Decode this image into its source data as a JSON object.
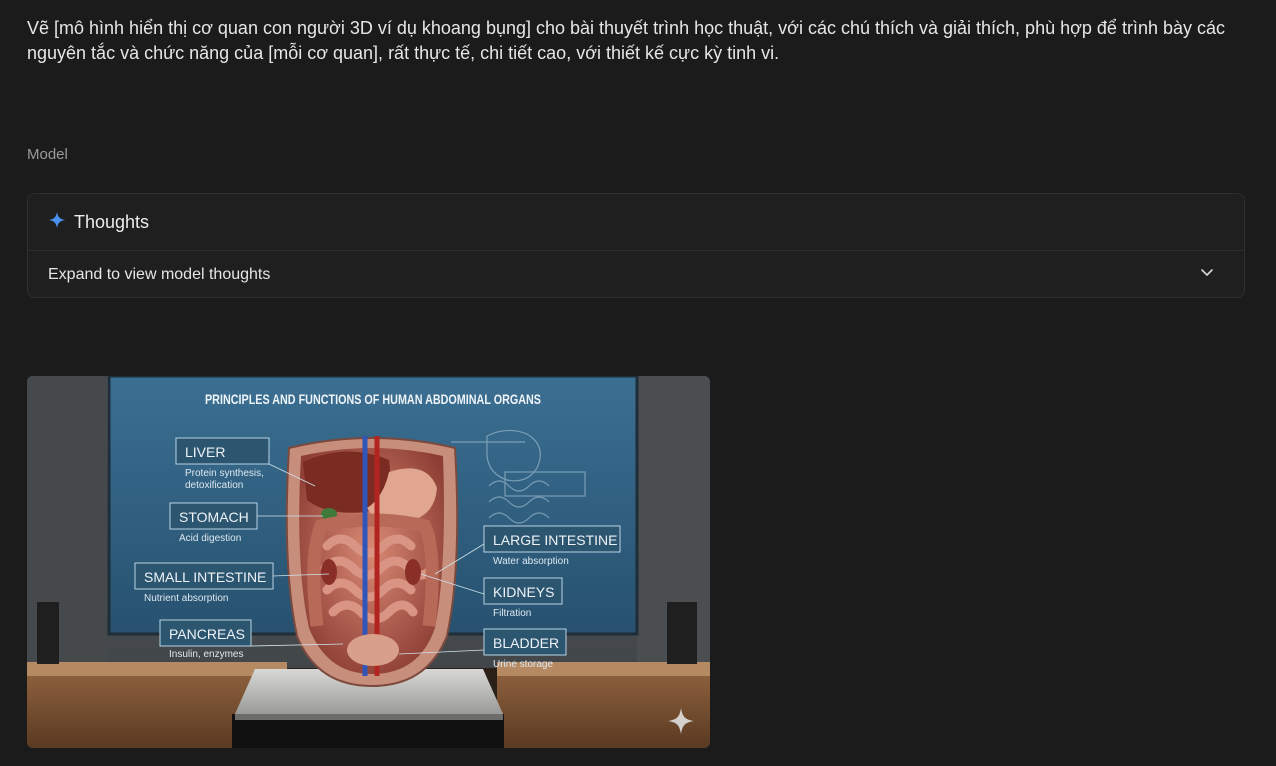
{
  "prompt": {
    "text": "Vẽ [mô hình hiển thị cơ quan con người 3D ví dụ khoang bụng] cho bài thuyết trình học thuật, với các chú thích và giải thích, phù hợp để trình bày các nguyên tắc và chức năng của [mỗi cơ quan], rất thực tế, chi tiết cao, với thiết kế cực kỳ tinh vi."
  },
  "response": {
    "role_label": "Model",
    "thoughts": {
      "title": "Thoughts",
      "expand_label": "Expand to view model thoughts",
      "icon": "sparkle-icon",
      "chevron": "chevron-down-icon"
    },
    "image": {
      "screen_title": "PRINCIPLES AND FUNCTIONS OF HUMAN ABDOMINAL ORGANS",
      "labels": [
        {
          "id": "liver",
          "name": "LIVER",
          "desc_line1": "Protein synthesis,",
          "desc_line2": "detoxification"
        },
        {
          "id": "stomach",
          "name": "STOMACH",
          "desc_line1": "Acid digestion",
          "desc_line2": ""
        },
        {
          "id": "small-intestine",
          "name": "SMALL INTESTINE",
          "desc_line1": "Nutrient absorption",
          "desc_line2": ""
        },
        {
          "id": "pancreas",
          "name": "PANCREAS",
          "desc_line1": "Insulin, enzymes",
          "desc_line2": ""
        },
        {
          "id": "large-intestine",
          "name": "LARGE INTESTINE",
          "desc_line1": "Water absorption",
          "desc_line2": ""
        },
        {
          "id": "kidneys",
          "name": "KIDNEYS",
          "desc_line1": "Filtration",
          "desc_line2": ""
        },
        {
          "id": "bladder",
          "name": "BLADDER",
          "desc_line1": "Urine storage",
          "desc_line2": ""
        }
      ],
      "watermark_icon": "sparkle-watermark-icon"
    }
  },
  "colors": {
    "background": "#1b1b1b",
    "card": "#1f1f1f",
    "accent_sparkle": "#4a90f0",
    "screen_blue": "#2f5d7e"
  }
}
